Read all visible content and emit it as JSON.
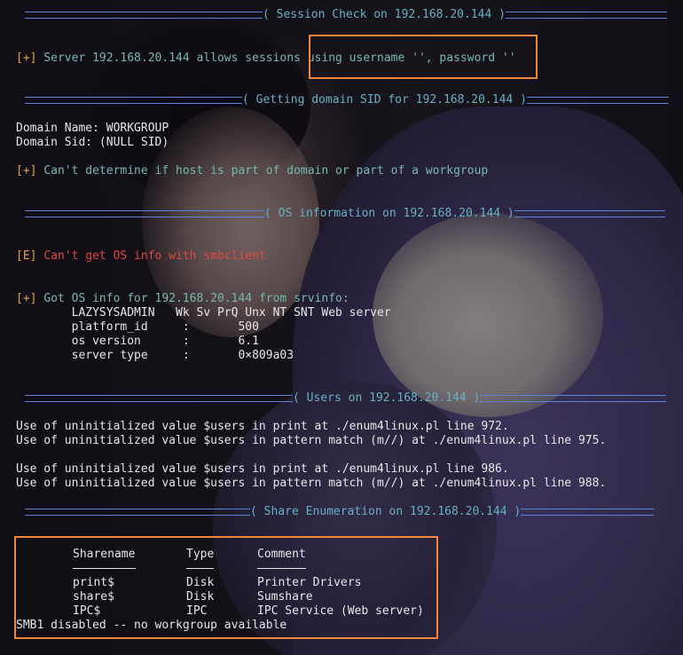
{
  "headers": {
    "session_check": "( Session Check on 192.168.20.144 )",
    "domain_sid": "( Getting domain SID for 192.168.20.144 )",
    "os_info": "( OS information on 192.168.20.144 )",
    "users": "( Users on 192.168.20.144 )",
    "share_enum": "( Share Enumeration on 192.168.20.144 )"
  },
  "session": {
    "prefix": "[+]",
    "message": "Server 192.168.20.144 allows sessions using username '', password ''"
  },
  "domain": {
    "name_line": "Domain Name: WORKGROUP",
    "sid_line": "Domain Sid: (NULL SID)",
    "prefix": "[+]",
    "message": "Can't determine if host is part of domain or part of a workgroup"
  },
  "os": {
    "error_prefix": "[E]",
    "error_message": "Can't get OS info with smbclient",
    "info_prefix": "[+]",
    "info_message": "Got OS info for 192.168.20.144 from srvinfo:",
    "lines": [
      "        LAZYSYSADMIN   Wk Sv PrQ Unx NT SNT Web server",
      "        platform_id     :       500",
      "        os version      :       6.1",
      "        server type     :       0×809a03"
    ]
  },
  "users": {
    "lines": [
      "Use of uninitialized value $users in print at ./enum4linux.pl line 972.",
      "Use of uninitialized value $users in pattern match (m//) at ./enum4linux.pl line 975.",
      "",
      "Use of uninitialized value $users in print at ./enum4linux.pl line 986.",
      "Use of uninitialized value $users in pattern match (m//) at ./enum4linux.pl line 988."
    ]
  },
  "shares": {
    "columns": [
      "Sharename",
      "Type",
      "Comment"
    ],
    "rows": [
      [
        "print$",
        "Disk",
        "Printer Drivers"
      ],
      [
        "share$",
        "Disk",
        "Sumshare"
      ],
      [
        "IPC$",
        "IPC",
        "IPC Service (Web server)"
      ]
    ],
    "footer": "SMB1 disabled -- no workgroup available"
  },
  "colors": {
    "text": "#e8e6ea",
    "success_text": "#78b7b0",
    "prefix": "#e2a14a",
    "error": "#e2473f",
    "header_text": "#66b0c6",
    "header_rule": "#5d83d8",
    "highlight_box": "#f0873a"
  }
}
